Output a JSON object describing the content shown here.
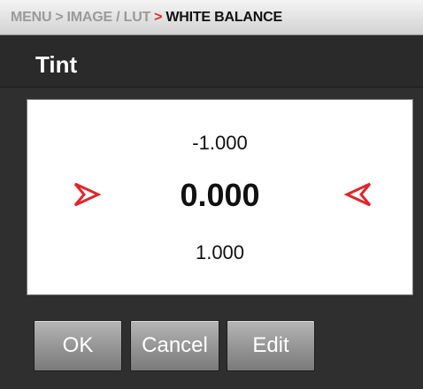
{
  "breadcrumb": {
    "items": [
      "MENU",
      "IMAGE / LUT"
    ],
    "separator": ">",
    "current": "WHITE BALANCE"
  },
  "header": {
    "title": "Tint"
  },
  "picker": {
    "value_above": "-1.000",
    "value_current": "0.000",
    "value_below": "1.000",
    "left_arrow_icon": "chevron-right-outline-icon",
    "right_arrow_icon": "chevron-left-outline-icon"
  },
  "buttons": {
    "ok_label": "OK",
    "cancel_label": "Cancel",
    "edit_label": "Edit"
  },
  "colors": {
    "accent": "#e0262a",
    "background": "#2f2f2f",
    "panel": "#ffffff",
    "button": "#9a9a9a"
  }
}
